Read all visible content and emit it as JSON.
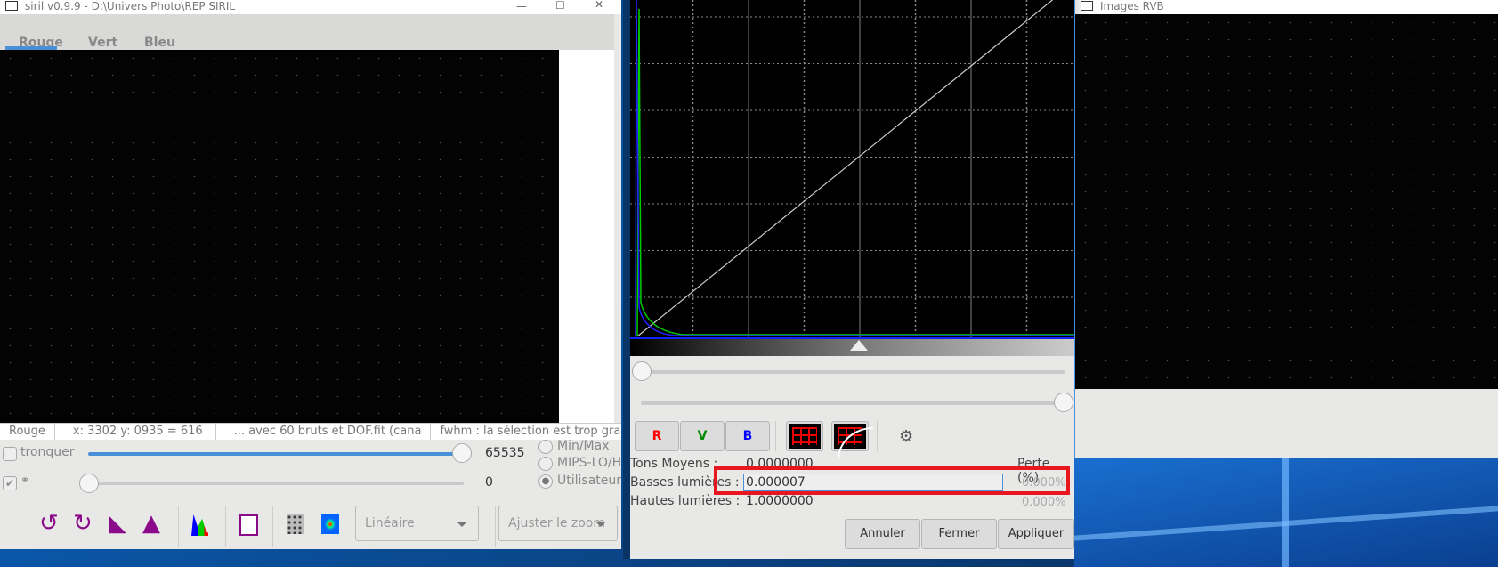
{
  "main_window": {
    "title": "siril v0.9.9 - D:\\Univers Photo\\REP SIRIL",
    "tabs": [
      {
        "label": "Rouge",
        "active": true
      },
      {
        "label": "Vert"
      },
      {
        "label": "Bleu"
      }
    ],
    "status": {
      "channel": "Rouge",
      "coords": "x: 3302 y: 0935 = 616",
      "file": "... avec 60 bruts et DOF.fit (cana",
      "fwhm": "fwhm : la sélection est trop grande"
    },
    "controls": {
      "tronquer_label": "tronquer",
      "high_value": "65535",
      "low_value": "0",
      "high_fraction": 1.0,
      "low_fraction": 0.0,
      "modes": [
        {
          "label": "Min/Max",
          "selected": false
        },
        {
          "label": "MIPS-LO/HI",
          "selected": false
        },
        {
          "label": "Utilisateur",
          "selected": true
        }
      ],
      "scale_select": "Linéaire",
      "zoom_select": "Ajuster le zoom"
    },
    "accent": "#4a90d9"
  },
  "histogram_dialog": {
    "channels": {
      "r": "R",
      "v": "V",
      "b": "B"
    },
    "midtones_label": "Tons Moyens :",
    "midtones_value": "0.0000000",
    "loss_label": "Perte (%)",
    "shadows_label": "Basses lumières :",
    "shadows_value": "0.000007",
    "shadows_loss": "0.000%",
    "highlights_label": "Hautes lumières :",
    "highlights_value": "1.0000000",
    "highlights_loss": "0.000%",
    "buttons": {
      "cancel": "Annuler",
      "close": "Fermer",
      "apply": "Appliquer"
    },
    "highlight_color": "#e8161e"
  },
  "rgb_window": {
    "title": "Images RVB"
  }
}
